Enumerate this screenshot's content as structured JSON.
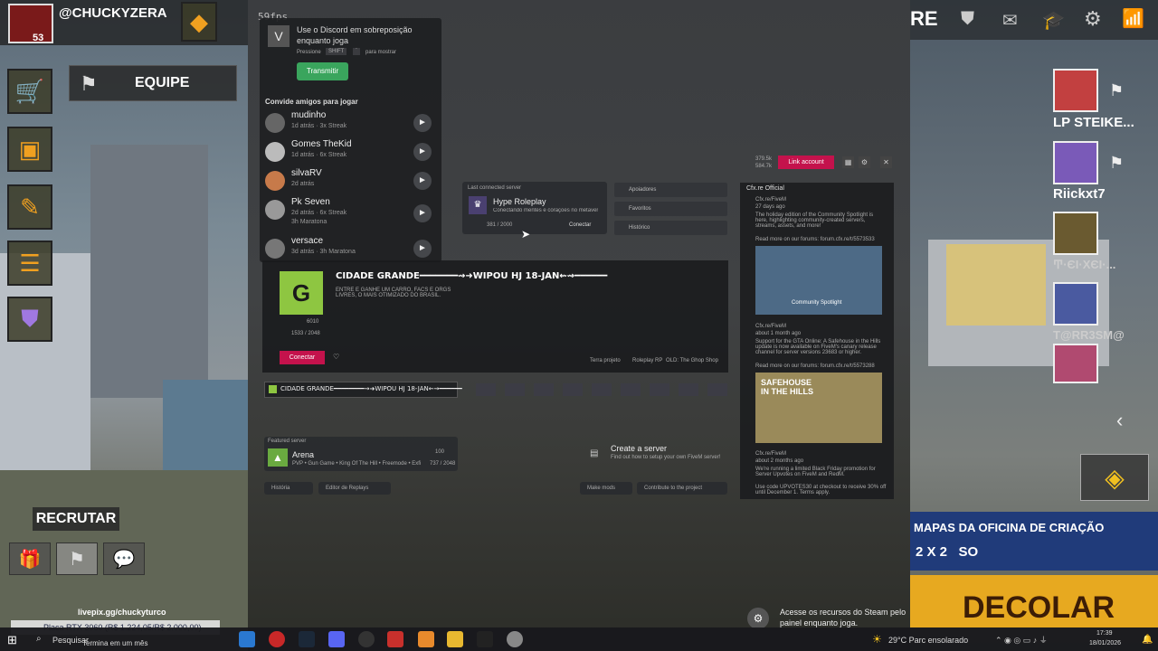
{
  "fps": "59fps",
  "left_hud": {
    "username": "@CHUCKYZERA",
    "level": "53",
    "equipe": "EQUIPE",
    "recrutar": "RECRUTAR",
    "livepix_url": "livepix.gg/chuckyturco",
    "livepix_note": "Placa RTX 3060 (R$ 1.224,05/R$ 2.000,00)",
    "ends_text": "Termina em um mês"
  },
  "discord": {
    "heading_line1": "Use o Discord em sobreposição",
    "heading_line2": "enquanto joga",
    "press": "Pressione",
    "key1": "SHIFT",
    "key2": "`",
    "to_show": "para mostrar",
    "stream_button": "Transmitir",
    "invite_title": "Convide amigos para jogar",
    "friends": [
      {
        "name": "mudinho",
        "time": "1d atrás",
        "extra": "3x Streak"
      },
      {
        "name": "Gomes TheKid",
        "time": "1d atrás",
        "extra": "6x Streak"
      },
      {
        "name": "silvaRV",
        "time": "2d atrás",
        "extra": ""
      },
      {
        "name": "Pk Seven",
        "time": "2d atrás",
        "extra": "6x Streak",
        "extra2": "3h Maratona"
      },
      {
        "name": "versace",
        "time": "3d atrás",
        "extra": "3h Maratona"
      }
    ]
  },
  "fivem": {
    "stats_line1": "379.5k",
    "stats_line2": "584.7k",
    "link_account": "Link account",
    "last_connected_label": "Last connected server",
    "last_server_name": "Hype Roleplay",
    "last_server_desc": "Conectando mentes e corações no metaverso",
    "last_server_players": "381 / 2000",
    "connect_small": "Conectar",
    "menu": [
      "Apoiadores",
      "Favoritos",
      "Histórico"
    ],
    "main_server_title": "CIDADE GRANDE━━━━━━━⇝➜WIPOU HJ 18-JAN⇜⇝━━━━━━",
    "main_server_desc": "ENTRE E GANHE UM CARRO, FACS E ORGS LIVRES, O MAIS OTIMIZADO DO BRASIL.",
    "main_server_votes": "6010",
    "main_server_players": "1533 / 2048",
    "connect_button": "Conectar",
    "tags": [
      "Terra projeto",
      "Roleplay RP",
      "OLD: The Ghop Shop"
    ],
    "strip_title": "CIDADE GRANDE━━━━━━━━⇝➜WIPOU HJ 18-JAN⇜⇝━━━━━━",
    "featured_label": "Featured server",
    "featured_name": "Arena",
    "featured_desc": "PVP • Gun Game • King Of The Hill • Freemode • Exfi",
    "featured_votes": "100",
    "featured_players": "737 / 2048",
    "create_title": "Create a server",
    "create_desc": "Find out how to setup your own FiveM server!",
    "bottom_left": [
      "História",
      "Editor de Replays"
    ],
    "bottom_right": [
      "Make mods",
      "Contribute to the project"
    ]
  },
  "news": {
    "header": "Cfx.re Official",
    "items": [
      {
        "author": "Cfx.re/FiveM",
        "time": "27 days ago",
        "text": "The holiday edition of the Community Spotlight is here, highlighting community-created servers, streams, assets, and more!",
        "link": "Read more on our forums: forum.cfx.re/t/5573533",
        "img_caption": "Community Spotlight"
      },
      {
        "author": "Cfx.re/FiveM",
        "time": "about 1 month ago",
        "text": "Support for the GTA Online: A Safehouse in the Hills update is now available on FiveM's canary release channel for server versions 23683 or higher.",
        "link": "Read more on our forums: forum.cfx.re/t/5573288",
        "img_caption": "SAFEHOUSE IN THE HILLS"
      },
      {
        "author": "Cfx.re/FiveM",
        "time": "about 2 months ago",
        "text": "We're running a limited Black Friday promotion for Server Upvotes on FiveM and RedM.",
        "link": "Use code UPVOTES30 at checkout to receive 30% off until December 1. Terms apply.",
        "img_caption": ""
      }
    ]
  },
  "steam": {
    "line1": "Acesse os recursos do Steam pelo",
    "line2": "painel enquanto joga."
  },
  "right_hud": {
    "names": [
      "LP STEIKE...",
      "Riickxt7",
      "Ͳ·ЄΙ·ХЄΙ·...",
      "T@RR3SM@"
    ],
    "banner_title": "MAPAS DA OFICINA DE CRIAÇÃO",
    "banner_mode": "2 X 2   SO",
    "decolar": "DECOLAR"
  },
  "taskbar": {
    "search": "Pesquisar",
    "weather": "29°C  Parc ensolarado",
    "time": "17:39",
    "date": "18/01/2026"
  },
  "colors": {
    "accent_pink": "#c4124c",
    "discord_green": "#3aa55d",
    "cfx_logo": "#8ec641"
  }
}
